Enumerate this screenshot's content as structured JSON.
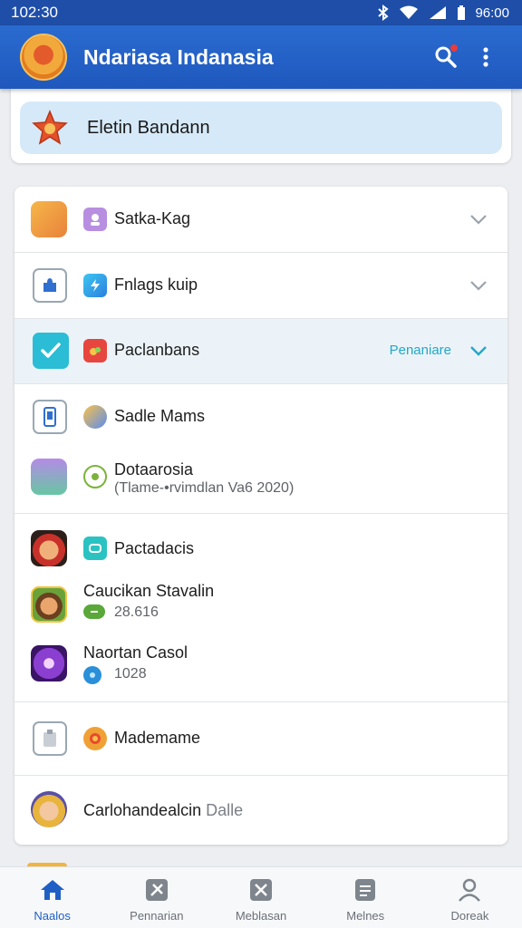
{
  "status_bar": {
    "time": "102:30",
    "clock_right": "96:00",
    "icons": [
      "bluetooth-icon",
      "wifi-icon",
      "signal-icon",
      "battery-icon"
    ]
  },
  "app_bar": {
    "title": "Ndariasa Indanasia",
    "actions": [
      "search-icon",
      "more-vert-icon"
    ]
  },
  "highlight": {
    "label": "Eletin Bandann"
  },
  "list": {
    "row1": {
      "label": "Satka-Kag"
    },
    "row2": {
      "label": "Fnlags kuip"
    },
    "row3": {
      "label": "Paclanbans",
      "badge": "Penaniare"
    },
    "row4": {
      "label": "Sadle Mams"
    },
    "row5": {
      "title": "Dotaarosia",
      "subtitle": "(Tlame-•rvimdlan Va6 2020)"
    },
    "row6": {
      "label": "Pactadacis"
    },
    "row7": {
      "title": "Caucikan Stavalin",
      "value": "28.616"
    },
    "row8": {
      "title": "Naortan Casol",
      "value": "1028"
    },
    "row9": {
      "label": "Mademame"
    },
    "row10": {
      "label": "Carlohandealcin",
      "suffix": "Dalle"
    }
  },
  "bottom_nav": {
    "items": [
      {
        "label": "Naalos",
        "icon": "home-icon"
      },
      {
        "label": "Pennarian",
        "icon": "tools-icon"
      },
      {
        "label": "Meblasan",
        "icon": "close-box-icon"
      },
      {
        "label": "Melnes",
        "icon": "document-icon"
      },
      {
        "label": "Doreak",
        "icon": "person-icon"
      }
    ]
  },
  "colors": {
    "primary": "#1f58bd",
    "accent": "#21a8c9",
    "highlight": "#d6e9f8"
  }
}
